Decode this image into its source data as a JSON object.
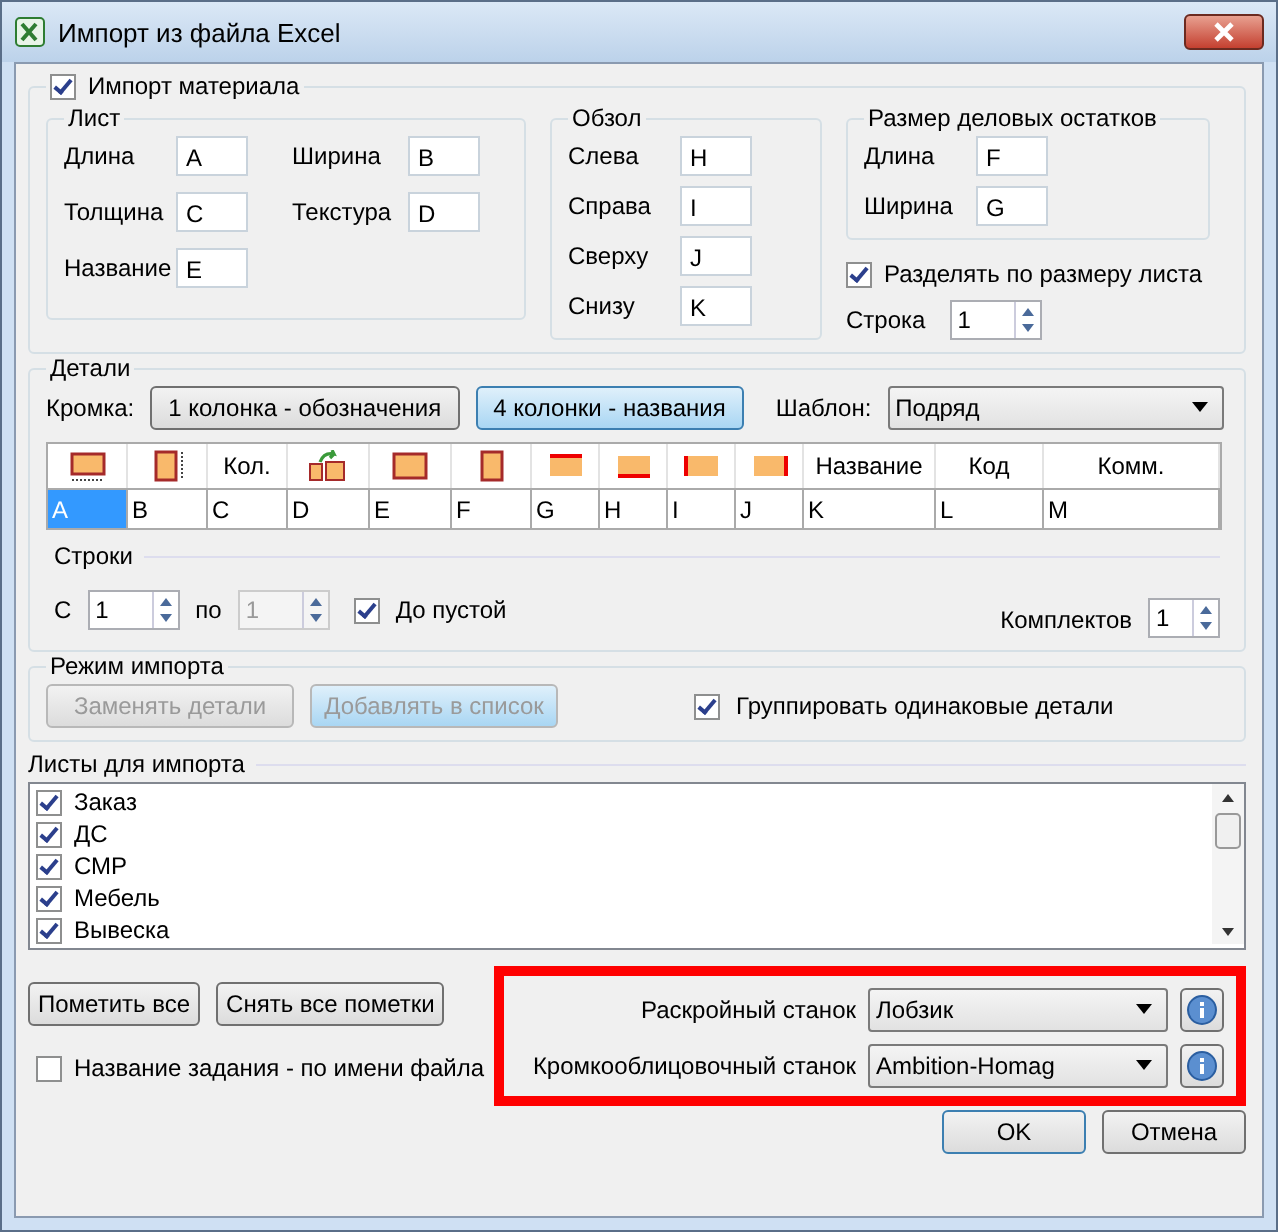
{
  "window": {
    "title": "Импорт из файла Excel"
  },
  "material": {
    "label": "Импорт материала",
    "checked": true
  },
  "sheet": {
    "title": "Лист",
    "fields": [
      {
        "label": "Длина",
        "value": "A"
      },
      {
        "label": "Ширина",
        "value": "B"
      },
      {
        "label": "Толщина",
        "value": "C"
      },
      {
        "label": "Текстура",
        "value": "D"
      },
      {
        "label": "Название",
        "value": "E"
      }
    ]
  },
  "trim": {
    "title": "Обзол",
    "fields": [
      {
        "label": "Слева",
        "value": "H"
      },
      {
        "label": "Справа",
        "value": "I"
      },
      {
        "label": "Сверху",
        "value": "J"
      },
      {
        "label": "Снизу",
        "value": "K"
      }
    ]
  },
  "remnants": {
    "title": "Размер деловых остатков",
    "fields": [
      {
        "label": "Длина",
        "value": "F"
      },
      {
        "label": "Ширина",
        "value": "G"
      }
    ]
  },
  "split": {
    "label": "Разделять по размеру листа",
    "checked": true
  },
  "row_field": {
    "label": "Строка",
    "value": "1"
  },
  "details": {
    "title": "Детали",
    "edge_label": "Кромка:",
    "edge_buttons": [
      {
        "label": "1 колонка - обозначения",
        "selected": false
      },
      {
        "label": "4 колонки - названия",
        "selected": true
      }
    ],
    "template": {
      "label": "Шаблон:",
      "value": "Подряд"
    },
    "columns": [
      {
        "kind": "icon"
      },
      {
        "kind": "icon"
      },
      {
        "kind": "text",
        "label": "Кол."
      },
      {
        "kind": "icon"
      },
      {
        "kind": "icon"
      },
      {
        "kind": "icon"
      },
      {
        "kind": "icon"
      },
      {
        "kind": "icon"
      },
      {
        "kind": "icon"
      },
      {
        "kind": "icon"
      },
      {
        "kind": "text",
        "label": "Название"
      },
      {
        "kind": "text",
        "label": "Код"
      },
      {
        "kind": "text",
        "label": "Комм."
      }
    ],
    "cells": [
      {
        "value": "A",
        "selected": true
      },
      {
        "value": "B",
        "selected": false
      },
      {
        "value": "C",
        "selected": false
      },
      {
        "value": "D",
        "selected": false
      },
      {
        "value": "E",
        "selected": false
      },
      {
        "value": "F",
        "selected": false
      },
      {
        "value": "G",
        "selected": false
      },
      {
        "value": "H",
        "selected": false
      },
      {
        "value": "I",
        "selected": false
      },
      {
        "value": "J",
        "selected": false
      },
      {
        "value": "K",
        "selected": false
      },
      {
        "value": "L",
        "selected": false
      },
      {
        "value": "M",
        "selected": false
      }
    ]
  },
  "rows": {
    "title": "Строки",
    "from_label": "С",
    "from": {
      "value": "1",
      "disabled": false
    },
    "to_label": "по",
    "to": {
      "value": "1",
      "disabled": true
    },
    "to_empty": {
      "label": "До пустой",
      "checked": true
    },
    "sets_label": "Комплектов",
    "sets": {
      "value": "1",
      "disabled": false
    }
  },
  "mode": {
    "title": "Режим импорта",
    "buttons": [
      {
        "label": "Заменять детали",
        "disabled": true,
        "selected": false
      },
      {
        "label": "Добавлять в список",
        "disabled": true,
        "selected": true
      }
    ],
    "group": {
      "label": "Группировать одинаковые детали",
      "checked": true
    }
  },
  "sheets": {
    "title": "Листы для импорта",
    "items": [
      {
        "label": "Заказ",
        "checked": true
      },
      {
        "label": "ДС",
        "checked": true
      },
      {
        "label": "СМР",
        "checked": true
      },
      {
        "label": "Мебель",
        "checked": true
      },
      {
        "label": "Вывеска",
        "checked": true
      }
    ]
  },
  "mark_buttons": [
    "Пометить все",
    "Снять все пометки"
  ],
  "job_name": {
    "label": "Название задания - по имени файла",
    "checked": false
  },
  "machines": [
    {
      "label": "Раскройный станок",
      "value": "Лобзик"
    },
    {
      "label": "Кромкооблицовочный станок",
      "value": "Ambition-Homag"
    }
  ],
  "buttons": [
    {
      "label": "OK",
      "default": true
    },
    {
      "label": "Отмена",
      "default": false
    }
  ]
}
